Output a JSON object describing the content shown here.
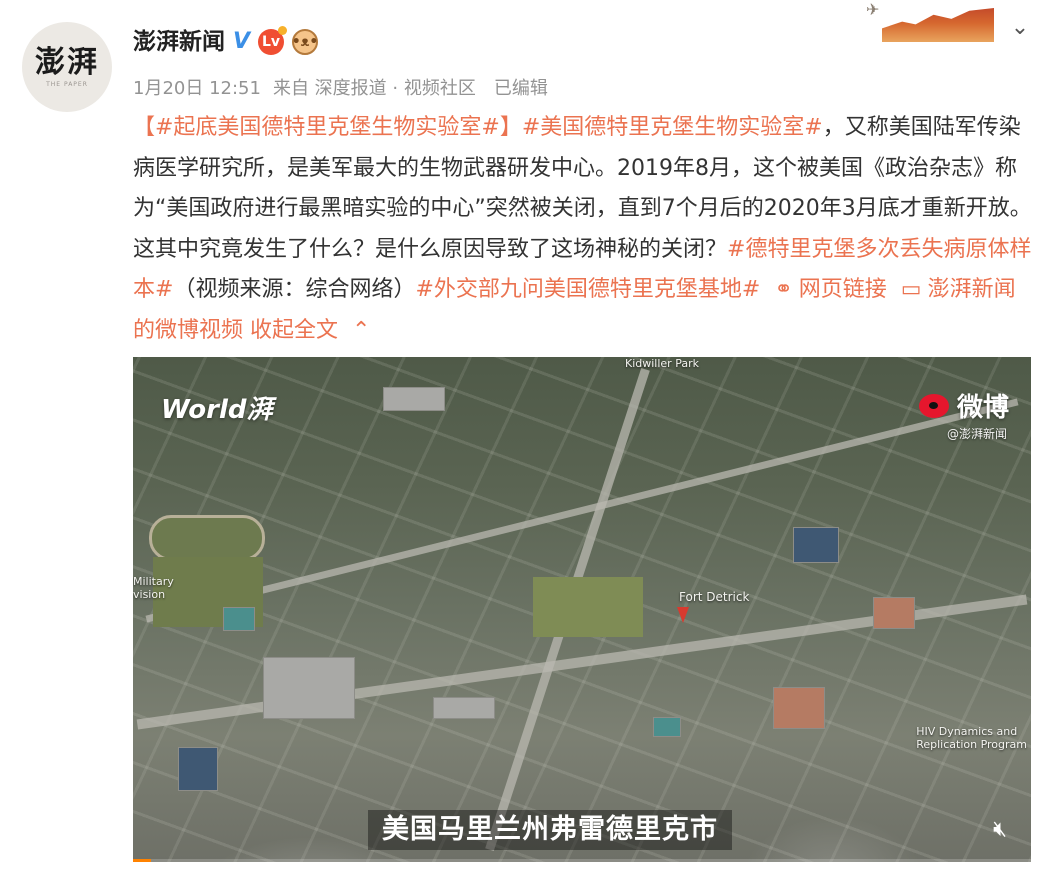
{
  "account": {
    "avatar_text": "澎湃",
    "avatar_subtext": "THE PAPER",
    "name": "澎湃新闻",
    "verified_mark": "V",
    "level_badge": "Lv"
  },
  "post": {
    "date": "1月20日 12:51",
    "source": "来自 深度报道 · 视频社区",
    "edited": "已编辑",
    "tags": {
      "t1": "【#起底美国德特里克堡生物实验室#】",
      "t2": "#美国德特里克堡生物实验室#",
      "t3": "#德特里克堡多次丢失病原体样本#",
      "t4": "#外交部九问美国德特里克堡基地#"
    },
    "text": {
      "p1": "，又称美国陆军传染病医学研究所，是美军最大的生物武器研发中心。2019年8月，这个被美国《政治杂志》称为“美国政府进行最黑暗实验的中心”突然被关闭，直到7个月后的2020年3月底才重新开放。这其中究竟发生了什么？是什么原因导致了这场神秘的关闭？",
      "p2": "（视频来源：综合网络）"
    },
    "links": {
      "web_link": "网页链接",
      "video_link": "澎湃新闻的微博视频",
      "collapse": "收起全文"
    }
  },
  "video": {
    "watermark_left": "World湃",
    "watermark_right": "微博",
    "watermark_handle": "@澎湃新闻",
    "caption": "美国马里兰州弗雷德里克市",
    "map_labels": {
      "fort": "Fort Detrick",
      "park": "Kidwiller Park",
      "military": "Military\nvision",
      "hiv": "HIV Dynamics and\nReplication Program"
    },
    "progress": 0.02
  },
  "icons": {
    "collapse_chevron": "chevron-down-icon",
    "link": "link-icon",
    "video": "video-icon",
    "collapse_up": "chevron-up-icon",
    "mute": "mute-icon",
    "accent_color": "#eb7350"
  }
}
